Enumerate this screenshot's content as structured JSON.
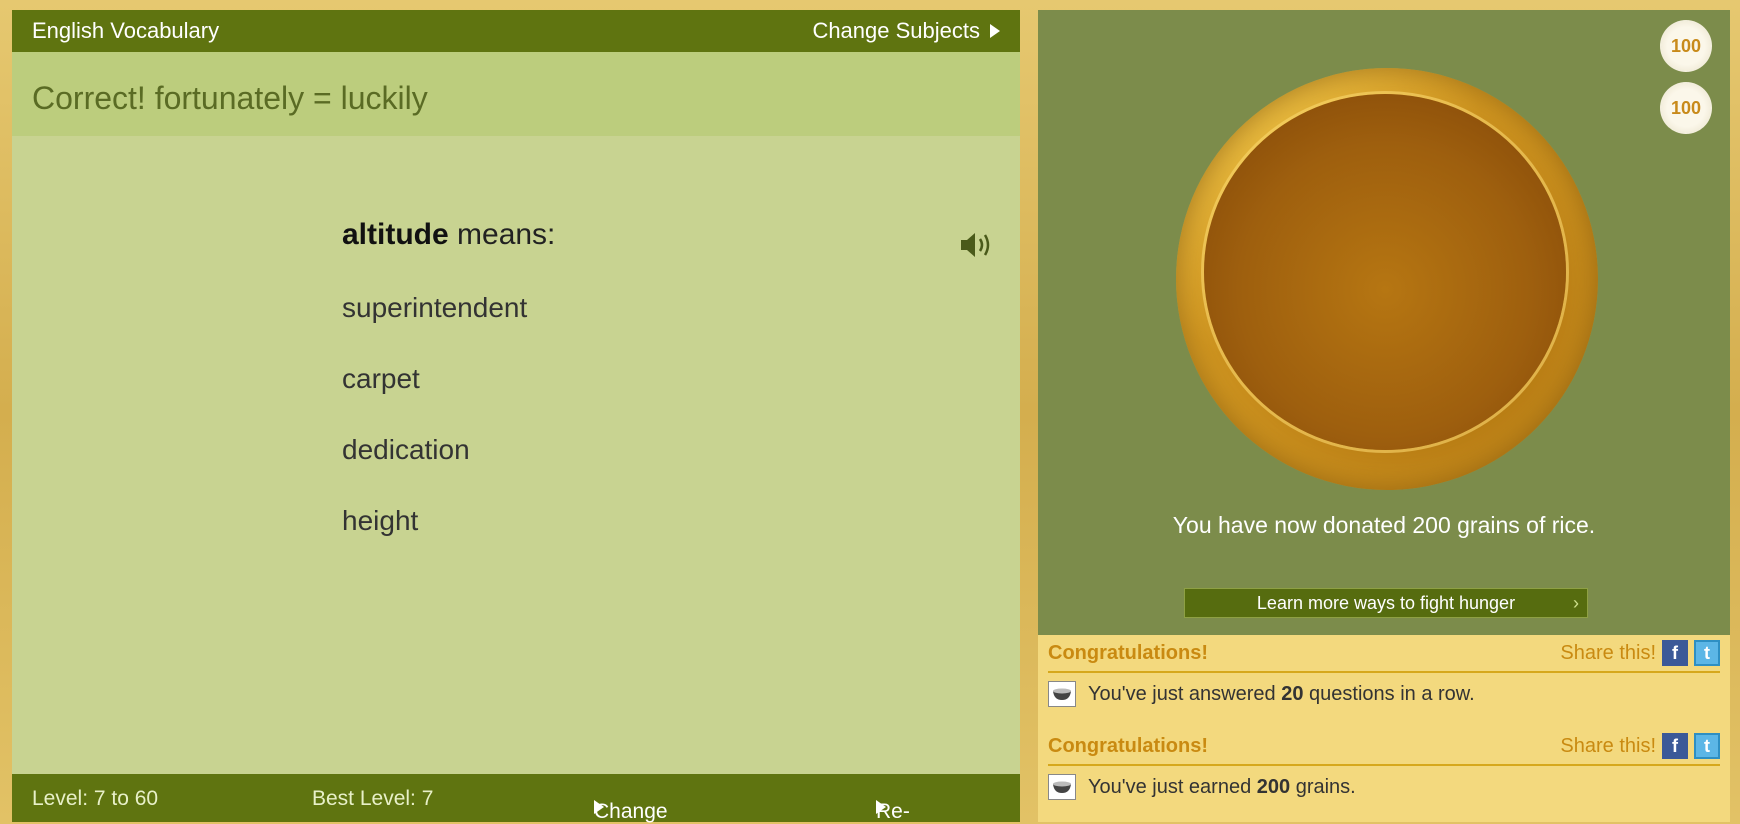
{
  "left": {
    "subject": "English Vocabulary",
    "change_subjects": "Change Subjects",
    "feedback": "Correct! fortunately = luckily",
    "question": {
      "word": "altitude",
      "suffix": "means:"
    },
    "choices": [
      "superintendent",
      "carpet",
      "dedication",
      "height"
    ],
    "footer": {
      "level": "Level: 7 to 60",
      "best_level": "Best Level: 7",
      "change_level": "Change Level",
      "restart": "Re-Start"
    }
  },
  "right": {
    "badges": [
      "100",
      "100"
    ],
    "donated": "You have now donated 200 grains of rice.",
    "learn_more": "Learn more ways to fight hunger",
    "congrats": [
      {
        "title": "Congratulations!",
        "share": "Share this!",
        "message_prefix": "You've just answered",
        "message_bold": "20",
        "message_suffix": "questions in a row."
      },
      {
        "title": "Congratulations!",
        "share": "Share this!",
        "message_prefix": "You've just earned",
        "message_bold": "200",
        "message_suffix": "grains."
      }
    ]
  },
  "colors": {
    "topbar": "#5f7410",
    "panel": "#c8d391",
    "right_panel": "#7c8c4b",
    "congrats_bg": "#f3d97e",
    "accent_orange": "#c98a11"
  }
}
